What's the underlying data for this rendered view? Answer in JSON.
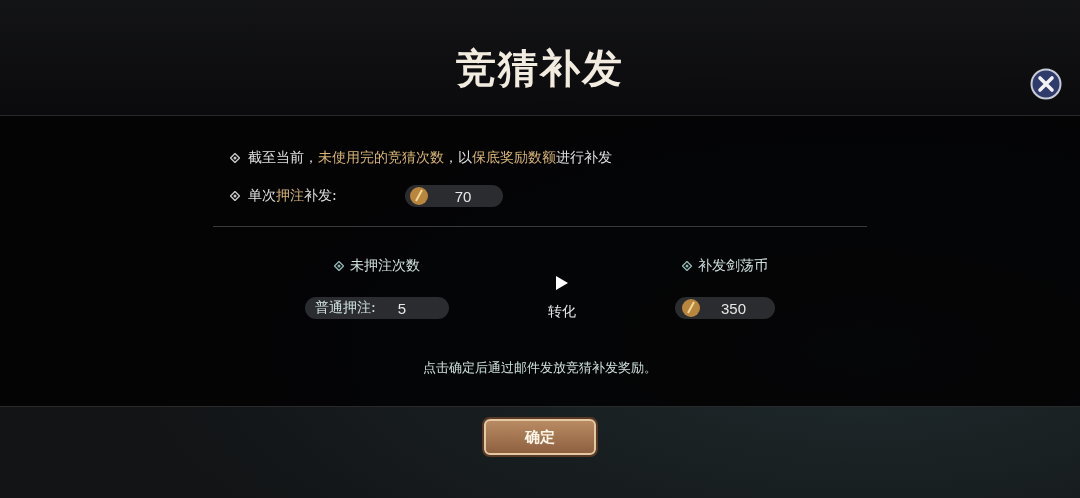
{
  "dialog": {
    "title": "竞猜补发",
    "notes": [
      {
        "text": "截至当前，**未使用完的竞猜次数**，以**保底奖励数额**进行补发"
      },
      {
        "text": "单次**押注**补发:",
        "amount": "70"
      }
    ],
    "left": {
      "heading": "未押注次数",
      "label": "普通押注:",
      "value": "5"
    },
    "convert_label": "转化",
    "right": {
      "heading": "补发剑荡币",
      "amount": "350"
    },
    "footnote": "点击确定后通过邮件发放竞猜补发奖励。",
    "confirm_button": "确定"
  }
}
